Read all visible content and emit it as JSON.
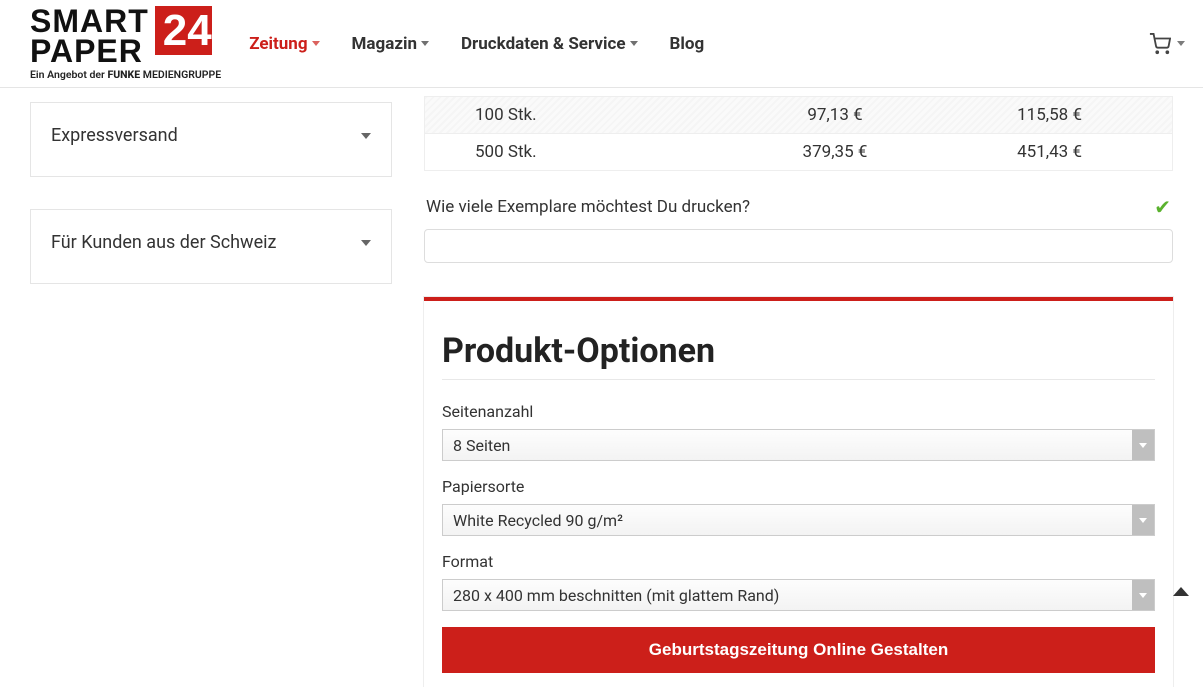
{
  "logo": {
    "line1": "SMART",
    "line2": "PAPER",
    "badge": "24",
    "strap_prefix": "Ein Angebot der ",
    "strap_bold": "FUNKE ",
    "strap_suffix": "MEDIENGRUPPE"
  },
  "nav": {
    "zeitung": "Zeitung",
    "magazin": "Magazin",
    "druck": "Druckdaten & Service",
    "blog": "Blog"
  },
  "sidebar": {
    "express": "Expressversand",
    "schweiz": "Für Kunden aus der Schweiz"
  },
  "price_table": {
    "rows": [
      {
        "qty": "100 Stk.",
        "p1": "97,13 €",
        "p2": "115,58 €"
      },
      {
        "qty": "500 Stk.",
        "p1": "379,35 €",
        "p2": "451,43 €"
      }
    ]
  },
  "qty_question": "Wie viele Exemplare möchtest Du drucken?",
  "options": {
    "title": "Produkt-Optionen",
    "pages_label": "Seitenanzahl",
    "pages_value": "8 Seiten",
    "paper_label": "Papiersorte",
    "paper_value": "White Recycled 90 g/m²",
    "format_label": "Format",
    "format_value": "280 x 400 mm beschnitten (mit glattem Rand)",
    "cta": "Geburtstagszeitung Online Gestalten"
  }
}
